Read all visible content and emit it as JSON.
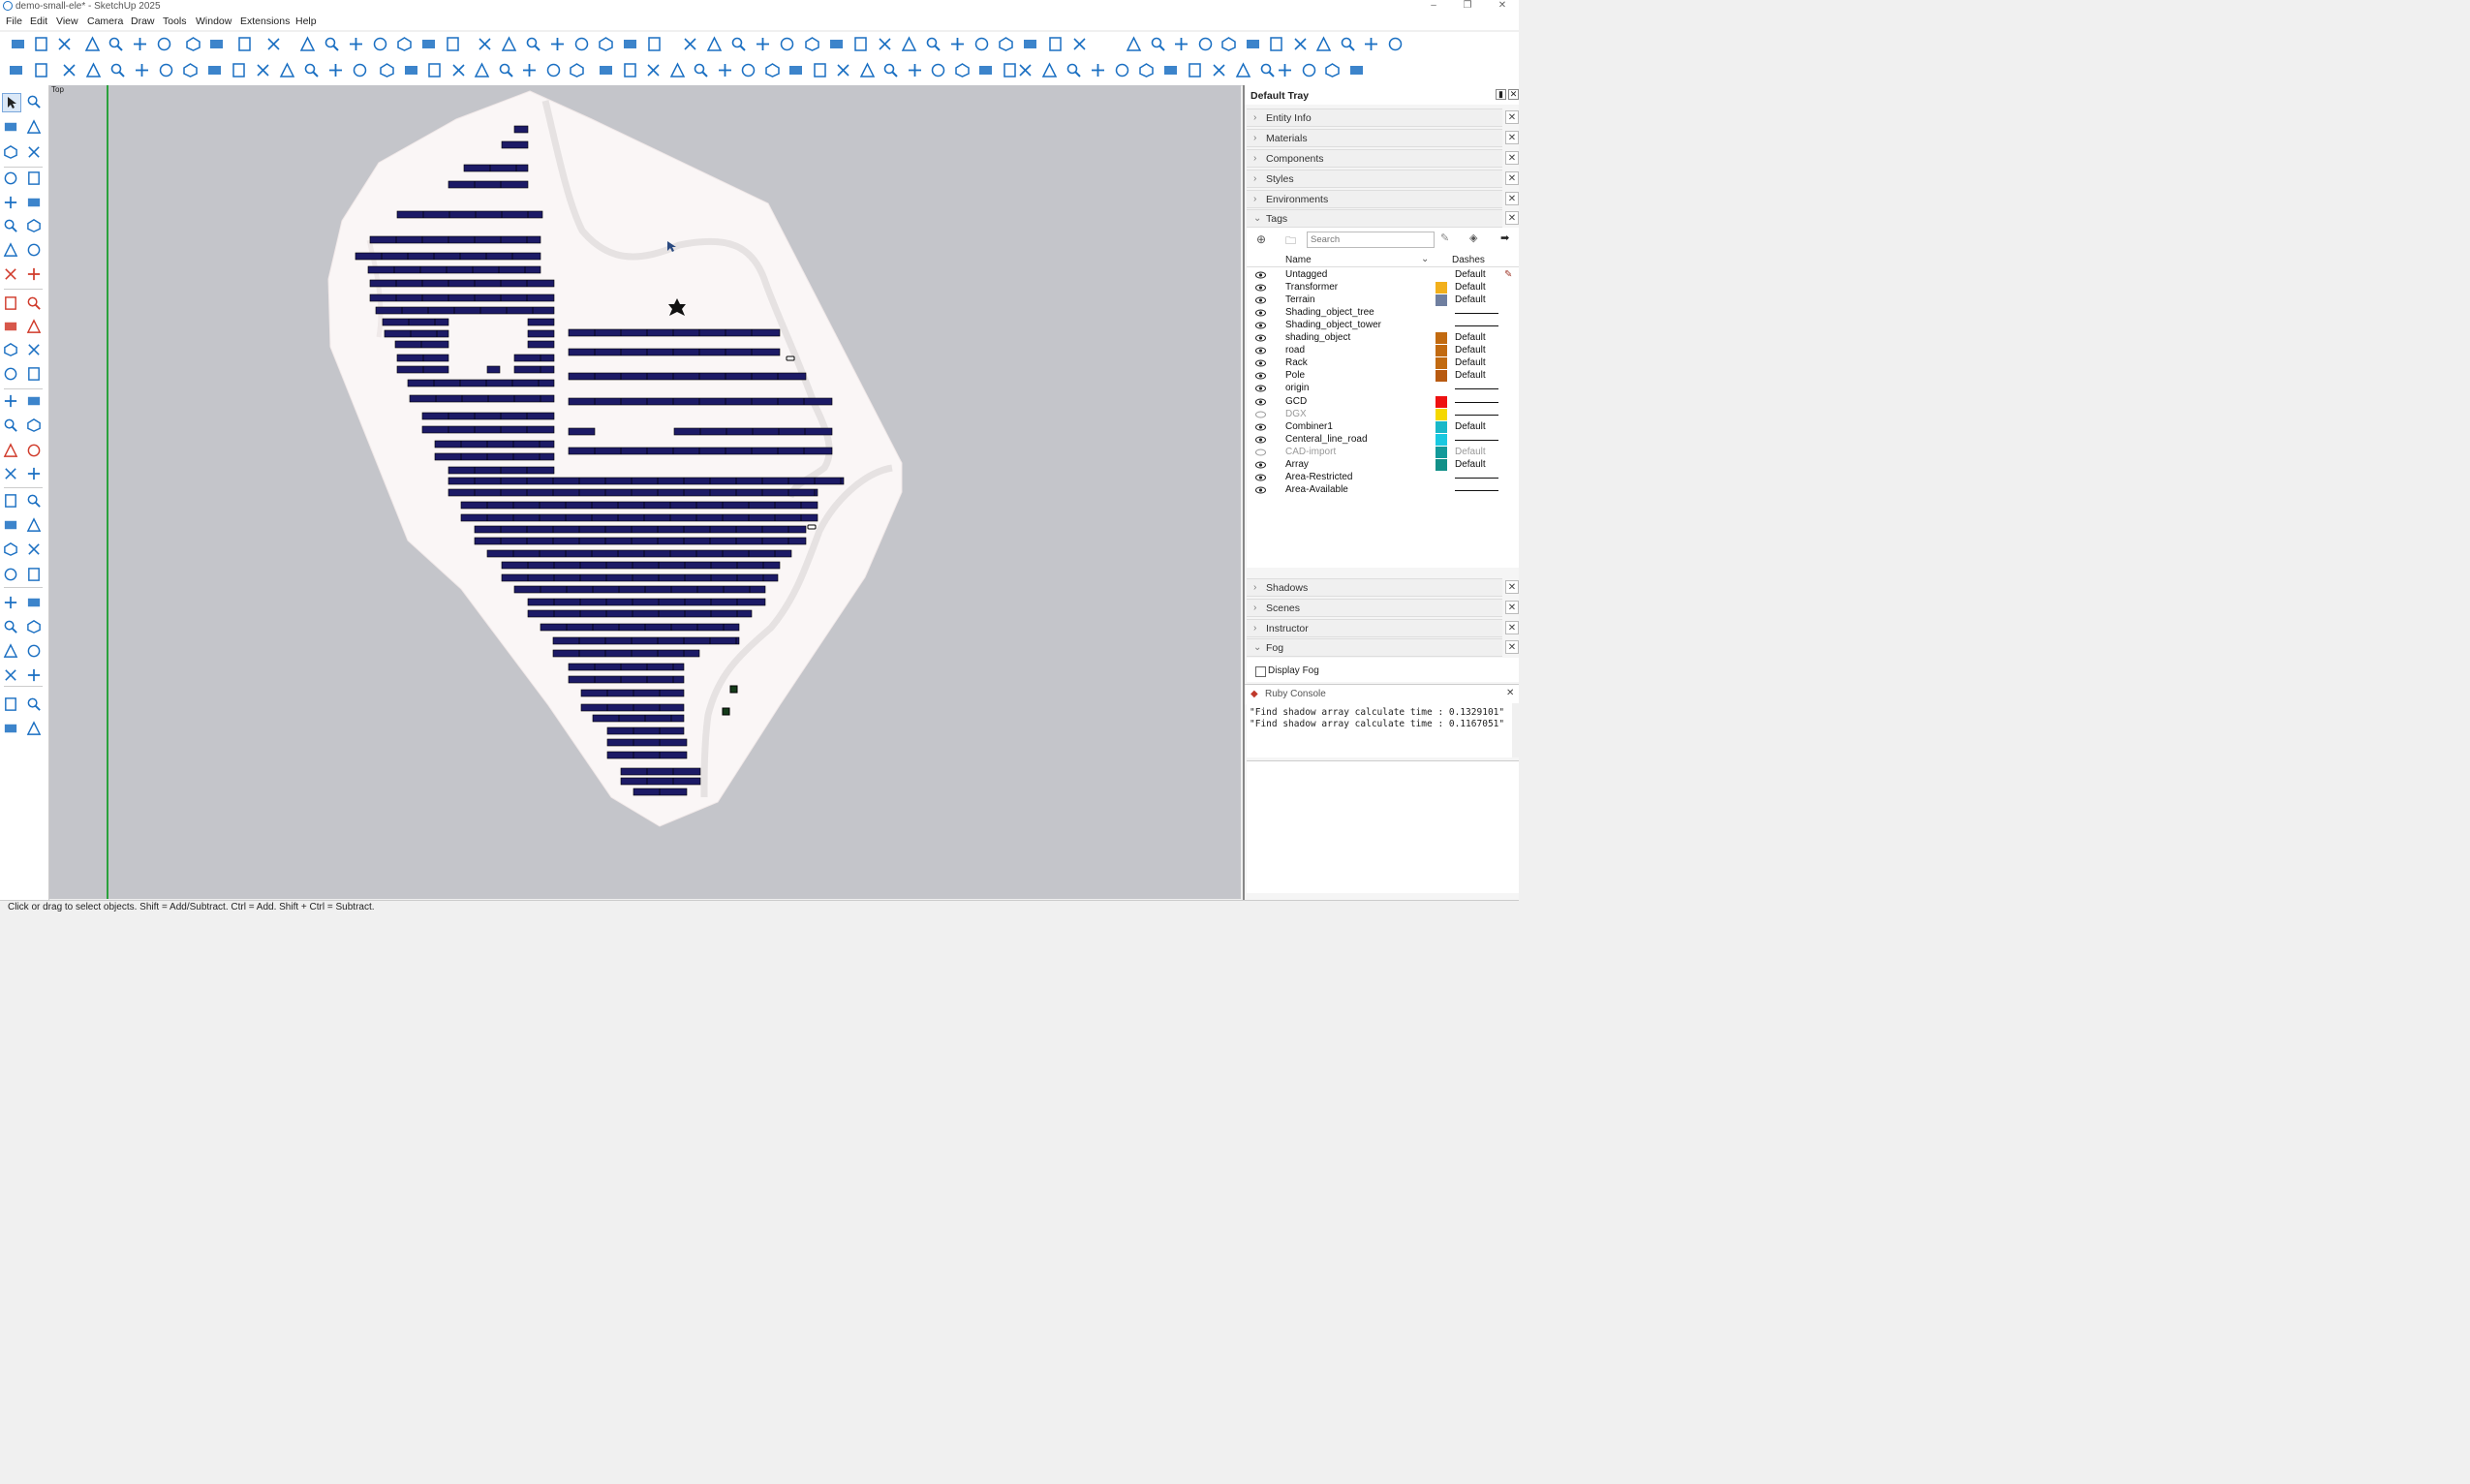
{
  "window": {
    "title": "demo-small-ele* - SketchUp 2025"
  },
  "menu": [
    "File",
    "Edit",
    "View",
    "Camera",
    "Draw",
    "Tools",
    "Window",
    "Extensions",
    "Help"
  ],
  "viewport": {
    "view_label": "Top"
  },
  "tray": {
    "title": "Default Tray",
    "panels_top": [
      {
        "label": "Entity Info",
        "expanded": false
      },
      {
        "label": "Materials",
        "expanded": false
      },
      {
        "label": "Components",
        "expanded": false
      },
      {
        "label": "Styles",
        "expanded": false
      },
      {
        "label": "Environments",
        "expanded": false
      },
      {
        "label": "Tags",
        "expanded": true
      }
    ],
    "tags": {
      "search_placeholder": "Search",
      "col_name": "Name",
      "col_dashes": "Dashes",
      "rows": [
        {
          "name": "Untagged",
          "visible": true,
          "color": "",
          "dashes": "Default",
          "pencil": true
        },
        {
          "name": "Transformer",
          "visible": true,
          "color": "#f2b01c",
          "dashes": "Default"
        },
        {
          "name": "Terrain",
          "visible": true,
          "color": "#6f7fa0",
          "dashes": "Default"
        },
        {
          "name": "Shading_object_tree",
          "visible": true,
          "color": "",
          "dashes": "line"
        },
        {
          "name": "Shading_object_tower",
          "visible": true,
          "color": "",
          "dashes": "line"
        },
        {
          "name": "shading_object",
          "visible": true,
          "color": "#c26a10",
          "dashes": "Default"
        },
        {
          "name": "road",
          "visible": true,
          "color": "#c26a10",
          "dashes": "Default"
        },
        {
          "name": "Rack",
          "visible": true,
          "color": "#c26a10",
          "dashes": "Default"
        },
        {
          "name": "Pole",
          "visible": true,
          "color": "#b85a10",
          "dashes": "Default"
        },
        {
          "name": "origin",
          "visible": true,
          "color": "",
          "dashes": "line"
        },
        {
          "name": "GCD",
          "visible": true,
          "color": "#ee1111",
          "dashes": "line"
        },
        {
          "name": "DGX",
          "visible": false,
          "color": "#f5d800",
          "dashes": "line"
        },
        {
          "name": "Combiner1",
          "visible": true,
          "color": "#19b8c8",
          "dashes": "Default"
        },
        {
          "name": "Centeral_line_road",
          "visible": true,
          "color": "#19c8e0",
          "dashes": "line"
        },
        {
          "name": "CAD-import",
          "visible": false,
          "color": "#129a9a",
          "dashes": "Default"
        },
        {
          "name": "Array",
          "visible": true,
          "color": "#129088",
          "dashes": "Default"
        },
        {
          "name": "Area-Restricted",
          "visible": true,
          "color": "",
          "dashes": "line"
        },
        {
          "name": "Area-Available",
          "visible": true,
          "color": "",
          "dashes": "line"
        }
      ]
    },
    "panels_bottom": [
      {
        "label": "Shadows",
        "expanded": false
      },
      {
        "label": "Scenes",
        "expanded": false
      },
      {
        "label": "Instructor",
        "expanded": false
      },
      {
        "label": "Fog",
        "expanded": true
      }
    ],
    "fog": {
      "display_fog_label": "Display Fog",
      "checked": false
    },
    "ruby_console": {
      "title": "Ruby Console",
      "lines": [
        "\"Find shadow array calculate time : 0.1329101\"",
        "\"Find shadow array calculate time : 0.1167051\""
      ]
    }
  },
  "status_bar": {
    "text": "Click or drag to select objects. Shift = Add/Subtract. Ctrl = Add. Shift + Ctrl = Subtract."
  },
  "colors": {
    "accent": "#1a6fc2",
    "panel_array": "#1c1a66",
    "terrain": "#faf6f6",
    "viewport_bg": "#c4c5ca"
  }
}
